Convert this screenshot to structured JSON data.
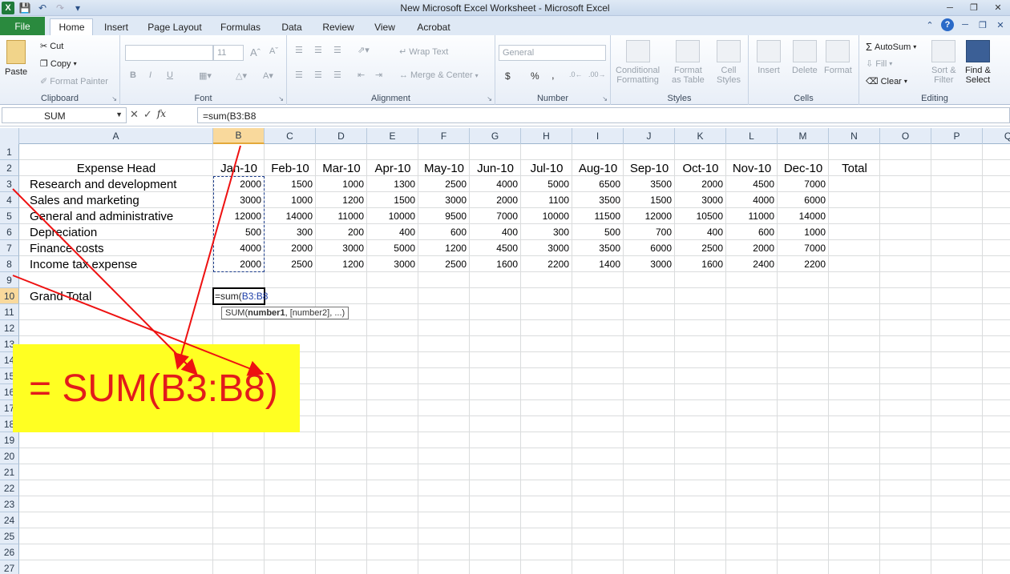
{
  "window": {
    "title": "New Microsoft Excel Worksheet  -  Microsoft Excel"
  },
  "tabs": {
    "file": "File",
    "home": "Home",
    "insert": "Insert",
    "page_layout": "Page Layout",
    "formulas": "Formulas",
    "data": "Data",
    "review": "Review",
    "view": "View",
    "acrobat": "Acrobat"
  },
  "ribbon": {
    "clipboard": {
      "label": "Clipboard",
      "paste": "Paste",
      "cut": "Cut",
      "copy": "Copy",
      "format_painter": "Format Painter"
    },
    "font": {
      "label": "Font",
      "size": "11",
      "bold": "B",
      "italic": "I",
      "underline": "U"
    },
    "alignment": {
      "label": "Alignment",
      "wrap_text": "Wrap Text",
      "merge_center": "Merge & Center"
    },
    "number": {
      "label": "Number",
      "format": "General",
      "currency": "$",
      "percent": "%",
      "comma": ","
    },
    "styles": {
      "label": "Styles",
      "conditional_l1": "Conditional",
      "conditional_l2": "Formatting",
      "format_table_l1": "Format",
      "format_table_l2": "as Table",
      "cell_styles_l1": "Cell",
      "cell_styles_l2": "Styles"
    },
    "cells": {
      "label": "Cells",
      "insert": "Insert",
      "delete": "Delete",
      "format": "Format"
    },
    "editing": {
      "label": "Editing",
      "autosum": "AutoSum",
      "fill": "Fill",
      "clear": "Clear",
      "sort_l1": "Sort &",
      "sort_l2": "Filter",
      "find_l1": "Find &",
      "find_l2": "Select"
    }
  },
  "formula_bar": {
    "name_box": "SUM",
    "fx": "fx",
    "formula": "=sum(B3:B8"
  },
  "columns": [
    "A",
    "B",
    "C",
    "D",
    "E",
    "F",
    "G",
    "H",
    "I",
    "J",
    "K",
    "L",
    "M",
    "N",
    "O",
    "P",
    "Q"
  ],
  "rows": [
    "1",
    "2",
    "3",
    "4",
    "5",
    "6",
    "7",
    "8",
    "9",
    "10",
    "11",
    "12",
    "13",
    "14",
    "15",
    "16",
    "17",
    "18",
    "19",
    "20",
    "21",
    "22",
    "23",
    "24",
    "25",
    "26",
    "27"
  ],
  "sheet": {
    "header_label": "Expense Head",
    "months": [
      "Jan-10",
      "Feb-10",
      "Mar-10",
      "Apr-10",
      "May-10",
      "Jun-10",
      "Jul-10",
      "Aug-10",
      "Sep-10",
      "Oct-10",
      "Nov-10",
      "Dec-10"
    ],
    "total_label": "Total",
    "expenses": [
      {
        "name": "Research and development",
        "values": [
          "2000",
          "1500",
          "1000",
          "1300",
          "2500",
          "4000",
          "5000",
          "6500",
          "3500",
          "2000",
          "4500",
          "7000"
        ]
      },
      {
        "name": "Sales and marketing",
        "values": [
          "3000",
          "1000",
          "1200",
          "1500",
          "3000",
          "2000",
          "1100",
          "3500",
          "1500",
          "3000",
          "4000",
          "6000"
        ]
      },
      {
        "name": "General and administrative",
        "values": [
          "12000",
          "14000",
          "11000",
          "10000",
          "9500",
          "7000",
          "10000",
          "11500",
          "12000",
          "10500",
          "11000",
          "14000"
        ]
      },
      {
        "name": "Depreciation",
        "values": [
          "500",
          "300",
          "200",
          "400",
          "600",
          "400",
          "300",
          "500",
          "700",
          "400",
          "600",
          "1000"
        ]
      },
      {
        "name": "Finance costs",
        "values": [
          "4000",
          "2000",
          "3000",
          "5000",
          "1200",
          "4500",
          "3000",
          "3500",
          "6000",
          "2500",
          "2000",
          "7000"
        ]
      },
      {
        "name": "Income tax expense",
        "values": [
          "2000",
          "2500",
          "1200",
          "3000",
          "2500",
          "1600",
          "2200",
          "1400",
          "3000",
          "1600",
          "2400",
          "2200"
        ]
      }
    ],
    "grand_total_label": "Grand Total",
    "active_cell": {
      "prefix": "=sum(",
      "ref": "B3:B8"
    },
    "tooltip": {
      "fn": "SUM(",
      "arg1": "number1",
      "rest": ", [number2], ...)"
    }
  },
  "callout": {
    "text": "= SUM(B3:B8)",
    "background": "#ffff22",
    "color": "#e21b1b"
  },
  "colors": {
    "file_tab": "#2a8a3e",
    "selected_header": "#f9d99c",
    "arrow": "#ee1111"
  }
}
